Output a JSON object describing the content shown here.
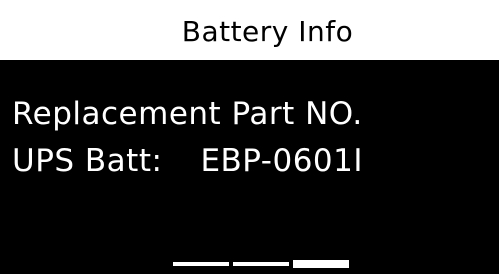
{
  "header": {
    "title": "Battery Info"
  },
  "content": {
    "line1": "Replacement Part NO.",
    "line2_label": "UPS Batt:",
    "line2_value": "EBP-0601I"
  },
  "page_indicator": {
    "total_pages": 3,
    "current_page": 3
  },
  "colors": {
    "header_background": "#ffffff",
    "header_text": "#000000",
    "screen_background": "#000000",
    "screen_text": "#ffffff"
  }
}
